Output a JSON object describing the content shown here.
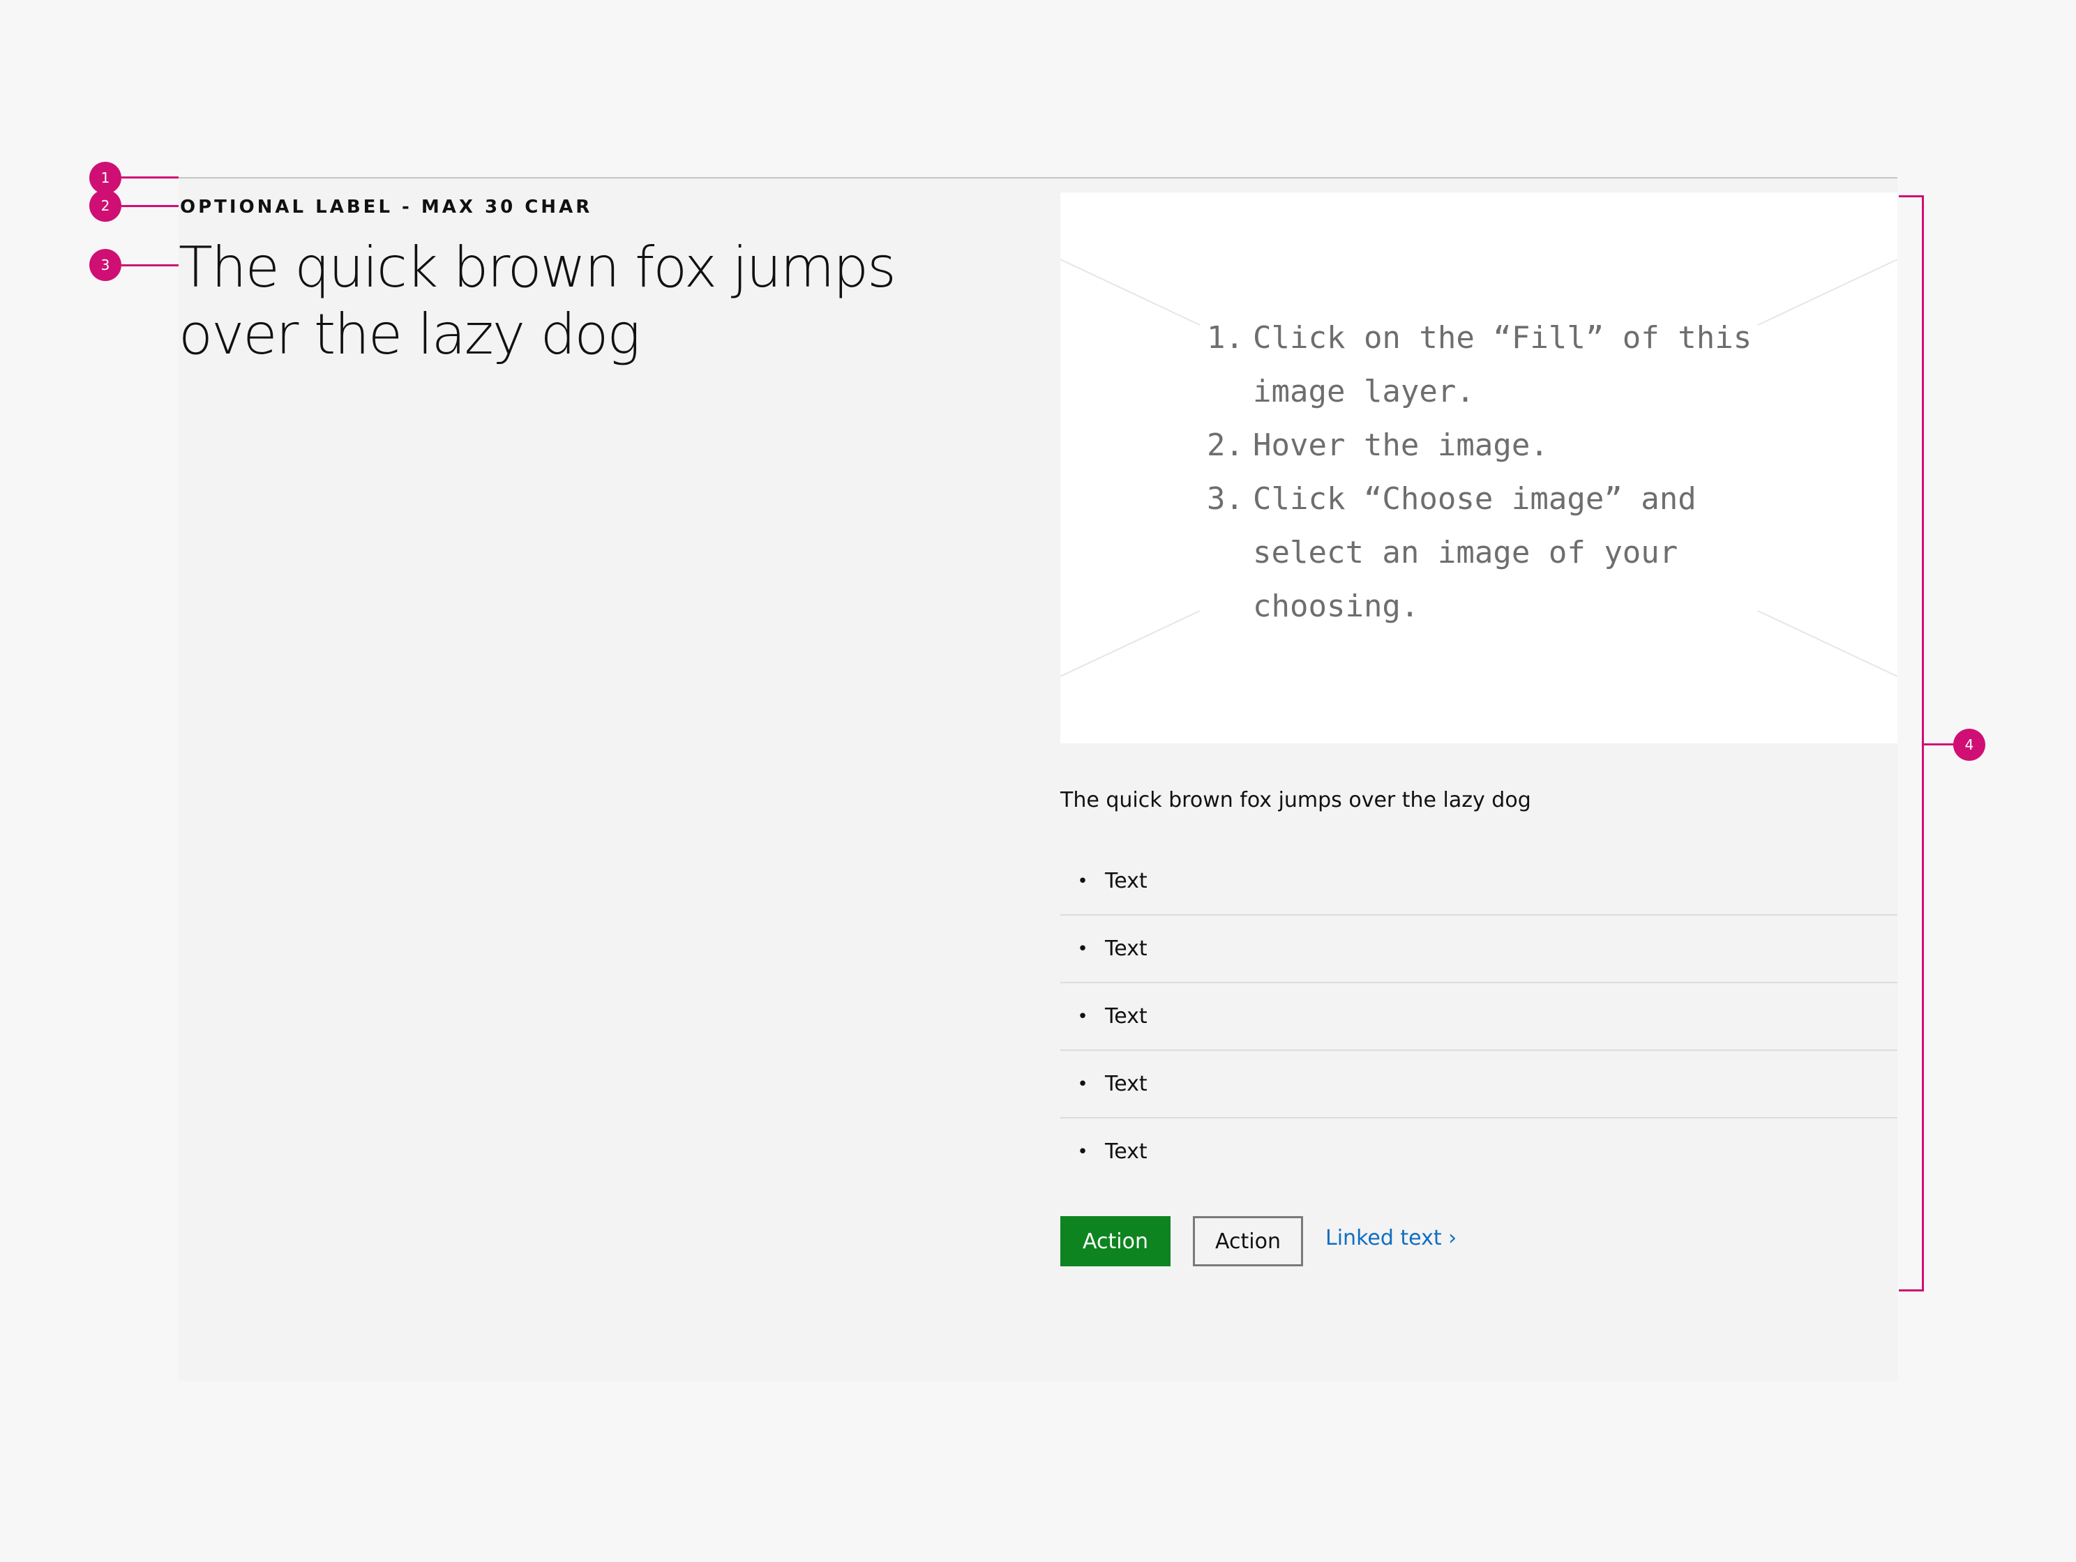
{
  "label": "OPTIONAL LABEL - MAX 30 CHAR",
  "heading": "The quick brown fox jumps over the lazy dog",
  "image_placeholder": {
    "steps": [
      {
        "num": "1.",
        "text": "Click on the “Fill” of this image layer."
      },
      {
        "num": "2.",
        "text": "Hover the image."
      },
      {
        "num": "3.",
        "text": "Click “Choose image” and select an image of your choosing."
      }
    ]
  },
  "description": "The quick brown fox jumps over the lazy dog",
  "list_items": [
    "Text",
    "Text",
    "Text",
    "Text",
    "Text"
  ],
  "bullet": "•",
  "actions": {
    "primary_label": "Action",
    "secondary_label": "Action",
    "link_label": "Linked text ›"
  },
  "annotations": [
    "1",
    "2",
    "3",
    "4"
  ],
  "colors": {
    "accent": "#cf0f73",
    "primary_button": "#0e8420",
    "link": "#0f6ec2"
  }
}
